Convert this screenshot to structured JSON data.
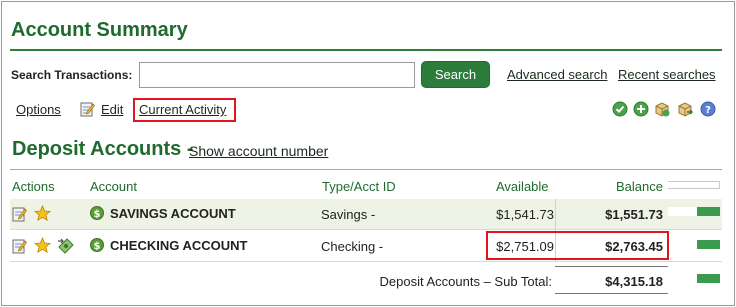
{
  "page": {
    "title": "Account Summary"
  },
  "search": {
    "label": "Search Transactions:",
    "value": "",
    "placeholder": "",
    "button_label": "Search",
    "advanced_link": "Advanced search",
    "recent_link": "Recent searches"
  },
  "toolbar": {
    "options_label": "Options",
    "edit_label": "Edit",
    "current_activity_label": "Current Activity",
    "icons": [
      "check-icon",
      "add-icon",
      "box-export-icon",
      "box-import-icon",
      "help-icon"
    ]
  },
  "deposit": {
    "title": "Deposit Accounts -",
    "show_account_link": "Show account number",
    "columns": {
      "actions": "Actions",
      "account": "Account",
      "type": "Type/Acct ID",
      "available": "Available",
      "balance": "Balance"
    },
    "rows": [
      {
        "name": "SAVINGS ACCOUNT",
        "type": "Savings -",
        "available": "$1,541.73",
        "balance": "$1,551.73",
        "bar_fraction": 0.45
      },
      {
        "name": "CHECKING ACCOUNT",
        "type": "Checking -",
        "available": "$2,751.09",
        "balance": "$2,763.45",
        "bar_fraction": 0.45
      }
    ],
    "subtotal": {
      "label": "Deposit Accounts – Sub Total:",
      "value": "$4,315.18",
      "bar_fraction": 0.45
    }
  },
  "colors": {
    "brand_green": "#1f6b2e",
    "button_green": "#2c7c3c",
    "highlight_red": "#e0141c",
    "row_tint": "#eef3e6"
  }
}
